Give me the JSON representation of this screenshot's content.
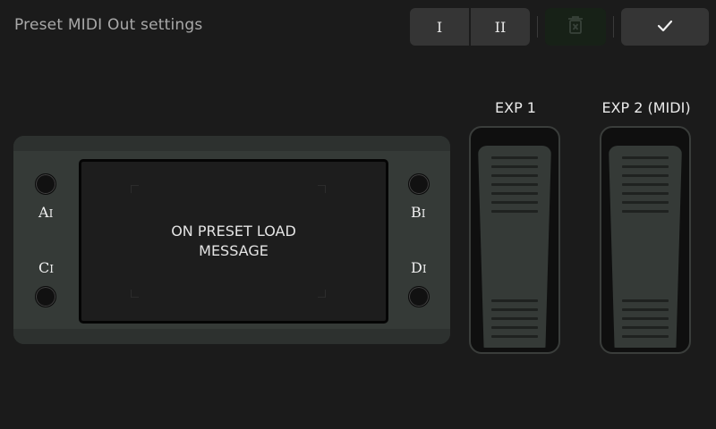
{
  "header": {
    "title": "Preset MIDI Out settings",
    "toggle_one_label": "I",
    "toggle_two_label": "II"
  },
  "icons": {
    "delete": "trash-x-icon",
    "confirm": "check-icon"
  },
  "footswitches": {
    "a": {
      "letter": "A",
      "sub": "I"
    },
    "b": {
      "letter": "B",
      "sub": "I"
    },
    "c": {
      "letter": "C",
      "sub": "I"
    },
    "d": {
      "letter": "D",
      "sub": "I"
    }
  },
  "screen": {
    "message": "ON PRESET LOAD\nMESSAGE"
  },
  "expression": {
    "exp1_label": "EXP 1",
    "exp2_label": "EXP 2 (MIDI)"
  },
  "colors": {
    "background": "#1b1b1b",
    "device": "#353a37",
    "button": "#353535",
    "delete_bg": "#172117"
  }
}
